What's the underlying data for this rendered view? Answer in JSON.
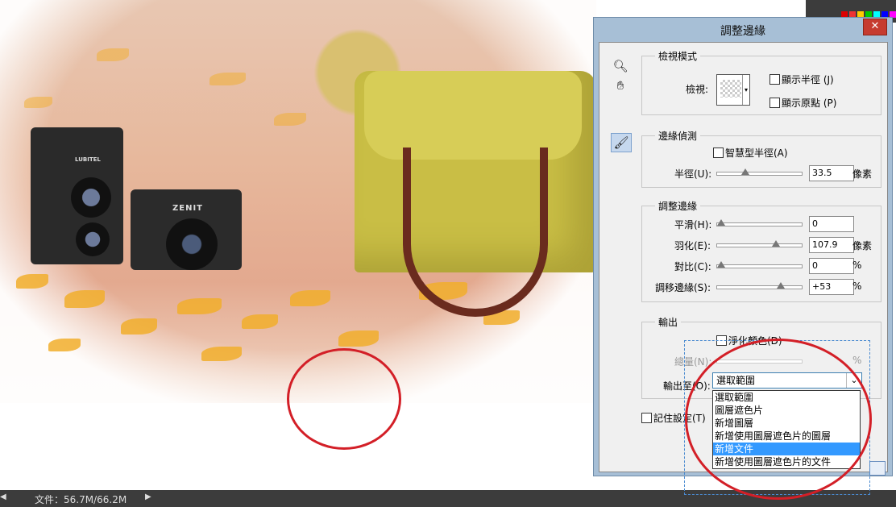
{
  "status_bar": {
    "doc_info": "文件：56.7M/66.2M"
  },
  "photo": {
    "camera1_brand": "LUBITEL",
    "camera2_brand": "ZENIT"
  },
  "dialog": {
    "title": "調整邊緣",
    "close_label": "✕",
    "view_mode": {
      "group_title": "檢視模式",
      "view_label": "檢視:",
      "show_radius": "顯示半徑 (J)",
      "show_original": "顯示原點 (P)"
    },
    "edge_detection": {
      "group_title": "邊緣偵測",
      "smart_radius": "智慧型半徑(A)",
      "radius_label": "半徑(U):",
      "radius_value": "33.5",
      "radius_unit": "像素",
      "radius_level": 0.32
    },
    "adjust_edge": {
      "group_title": "調整邊緣",
      "smooth_label": "平滑(H):",
      "smooth_value": "0",
      "smooth_level": 0,
      "feather_label": "羽化(E):",
      "feather_value": "107.9",
      "feather_unit": "像素",
      "feather_level": 0.72,
      "contrast_label": "對比(C):",
      "contrast_value": "0",
      "contrast_unit": "%",
      "contrast_level": 0,
      "shift_label": "調移邊緣(S):",
      "shift_value": "+53",
      "shift_unit": "%",
      "shift_level": 0.78
    },
    "output": {
      "group_title": "輸出",
      "decontaminate": "淨化顏色(D)",
      "amount_label": "總量(N):",
      "amount_unit": "%",
      "output_to_label": "輸出至(O):",
      "output_to_value": "選取範圍",
      "options": [
        "選取範圍",
        "圖層遮色片",
        "新增圖層",
        "新增使用圖層遮色片的圖層",
        "新增文件",
        "新增使用圖層遮色片的文件"
      ],
      "selected_option": "新增文件"
    },
    "remember_settings": "記住設定(T)"
  },
  "colors": {
    "dialog_frame": "#a7bfd6",
    "annotation_red": "#d31f27",
    "selection_blue": "#3399ff"
  }
}
